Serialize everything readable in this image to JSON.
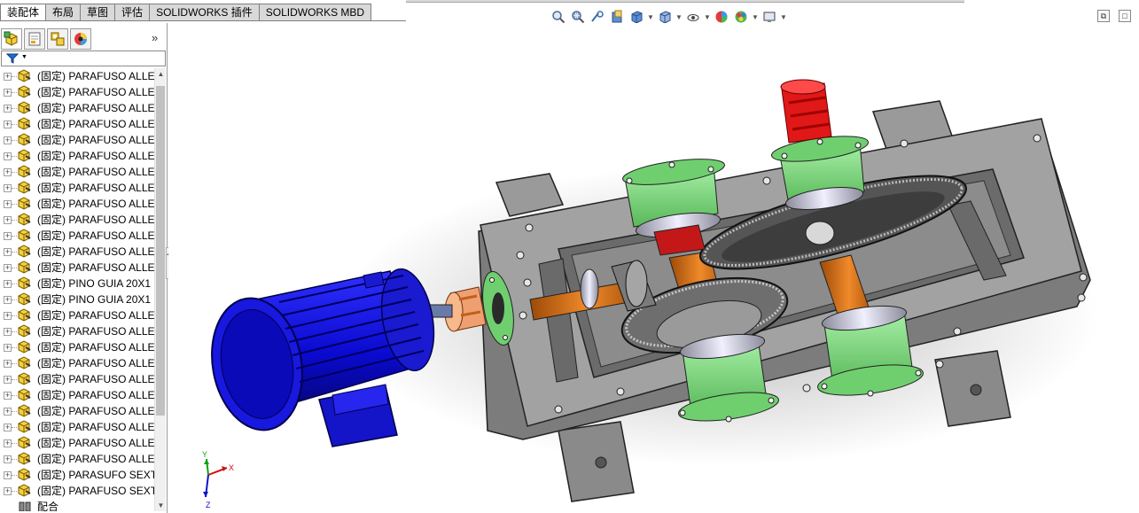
{
  "command_tabs": [
    "装配体",
    "布局",
    "草图",
    "评估",
    "SOLIDWORKS 插件",
    "SOLIDWORKS MBD"
  ],
  "manager_tabs": [
    "featuremanager-tab",
    "propertymanager-tab",
    "configurationmanager-tab",
    "displaymanager-tab"
  ],
  "manager_more": "»",
  "tree": {
    "items": [
      {
        "prefix": "(固定)",
        "name": "PARAFUSO ALLE"
      },
      {
        "prefix": "(固定)",
        "name": "PARAFUSO ALLE"
      },
      {
        "prefix": "(固定)",
        "name": "PARAFUSO ALLE"
      },
      {
        "prefix": "(固定)",
        "name": "PARAFUSO ALLE"
      },
      {
        "prefix": "(固定)",
        "name": "PARAFUSO ALLE"
      },
      {
        "prefix": "(固定)",
        "name": "PARAFUSO ALLE"
      },
      {
        "prefix": "(固定)",
        "name": "PARAFUSO ALLE"
      },
      {
        "prefix": "(固定)",
        "name": "PARAFUSO ALLE"
      },
      {
        "prefix": "(固定)",
        "name": "PARAFUSO ALLE"
      },
      {
        "prefix": "(固定)",
        "name": "PARAFUSO ALLE"
      },
      {
        "prefix": "(固定)",
        "name": "PARAFUSO ALLE"
      },
      {
        "prefix": "(固定)",
        "name": "PARAFUSO ALLE"
      },
      {
        "prefix": "(固定)",
        "name": "PARAFUSO ALLE"
      },
      {
        "prefix": "(固定)",
        "name": "PINO GUIA 20X1"
      },
      {
        "prefix": "(固定)",
        "name": "PINO GUIA 20X1"
      },
      {
        "prefix": "(固定)",
        "name": "PARAFUSO ALLE"
      },
      {
        "prefix": "(固定)",
        "name": "PARAFUSO ALLE"
      },
      {
        "prefix": "(固定)",
        "name": "PARAFUSO ALLE"
      },
      {
        "prefix": "(固定)",
        "name": "PARAFUSO ALLE"
      },
      {
        "prefix": "(固定)",
        "name": "PARAFUSO ALLE"
      },
      {
        "prefix": "(固定)",
        "name": "PARAFUSO ALLE"
      },
      {
        "prefix": "(固定)",
        "name": "PARAFUSO ALLE"
      },
      {
        "prefix": "(固定)",
        "name": "PARAFUSO ALLE"
      },
      {
        "prefix": "(固定)",
        "name": "PARAFUSO ALLE"
      },
      {
        "prefix": "(固定)",
        "name": "PARAFUSO ALLE"
      },
      {
        "prefix": "(固定)",
        "name": "PARASUFO SEXT"
      },
      {
        "prefix": "(固定)",
        "name": "PARAFUSO SEXT"
      }
    ],
    "partial_item": "配合"
  },
  "hud_tools": [
    "zoom-to-fit-icon",
    "zoom-to-area-icon",
    "previous-view-icon",
    "section-view-icon",
    "view-orientation-icon",
    "display-style-icon",
    "hide-show-items-icon",
    "edit-appearance-icon",
    "apply-scene-icon",
    "view-settings-icon"
  ],
  "triad": {
    "x": "X",
    "y": "Y",
    "z": "Z"
  },
  "colors": {
    "motor": "#1010d8",
    "housing": "#9a9a9a",
    "bearing_cap": "#7ed87e",
    "shaft": "#d2731c",
    "coupling_red": "#e01818",
    "coupling_orange": "#f0a070",
    "gear": "#6e6e6e"
  }
}
